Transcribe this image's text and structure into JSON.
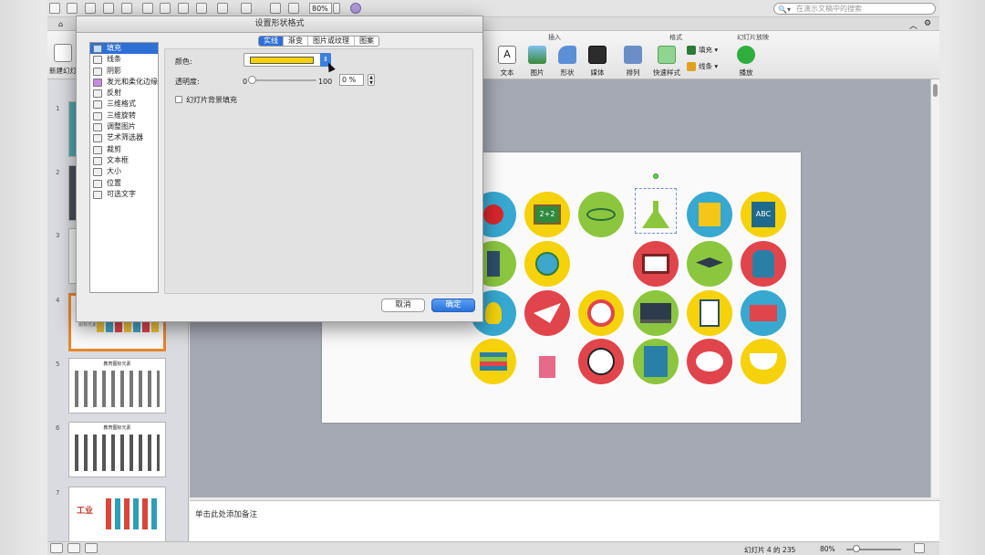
{
  "toolbar": {
    "zoom": "80%",
    "search_placeholder": "在演示文稿中的搜索"
  },
  "ribbon": {
    "group_insert": "插入",
    "group_format": "格式",
    "group_slideshow": "幻灯片放映",
    "new_slide": "新建幻灯片",
    "buttons": [
      "文本",
      "图片",
      "形状",
      "媒体",
      "排列",
      "快速样式",
      "播放"
    ],
    "fill": "填充",
    "line": "线条"
  },
  "thumbnails": {
    "numbers": [
      "1",
      "2",
      "3",
      "4",
      "5",
      "6",
      "7"
    ],
    "slide5_title": "教育图标元素",
    "slide6_title": "教育图标元素",
    "slide7_text": "工业"
  },
  "notes": {
    "placeholder": "单击此处添加备注"
  },
  "status": {
    "slide_info": "幻灯片 4 的 235",
    "zoom": "80%"
  },
  "dialog": {
    "title": "设置形状格式",
    "categories": [
      "填充",
      "线条",
      "阴影",
      "发光和柔化边缘",
      "反射",
      "三维格式",
      "三维旋转",
      "调整图片",
      "艺术筛选器",
      "裁剪",
      "文本框",
      "大小",
      "位置",
      "可选文字"
    ],
    "tabs": [
      "实线",
      "渐变",
      "图片或纹理",
      "图案"
    ],
    "color_label": "颜色:",
    "color_value": "#f5d20a",
    "transparency_label": "透明度:",
    "slider_min": "0",
    "slider_max": "100",
    "transparency_value": "0 %",
    "checkbox_label": "幻灯片背景填充",
    "cancel": "取消",
    "ok": "确定"
  }
}
